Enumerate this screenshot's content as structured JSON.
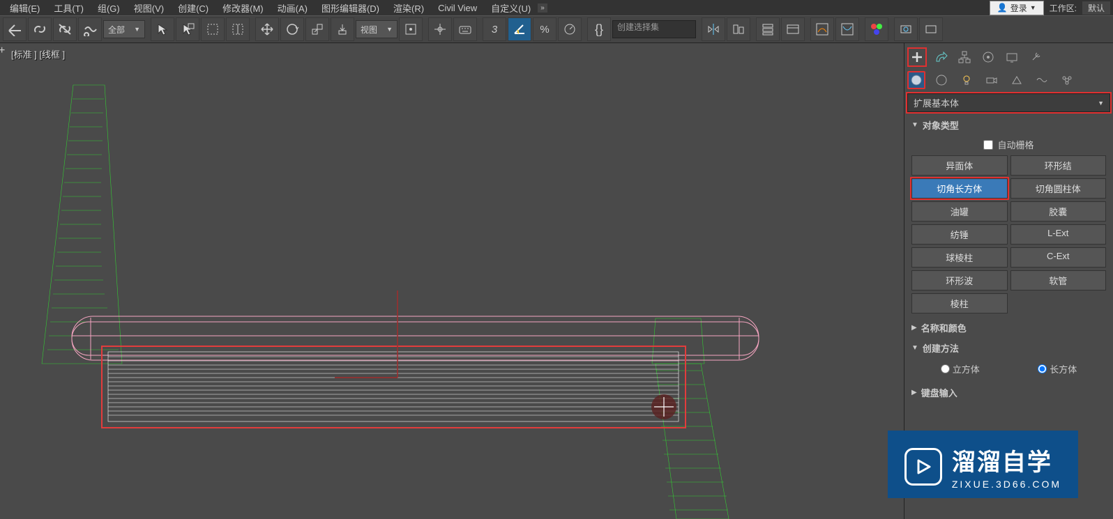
{
  "menu": {
    "items": [
      "编辑(E)",
      "工具(T)",
      "组(G)",
      "视图(V)",
      "创建(C)",
      "修改器(M)",
      "动画(A)",
      "图形编辑器(D)",
      "渲染(R)",
      "Civil View",
      "自定义(U)"
    ],
    "login_label": "登录",
    "workspace_label": "工作区:",
    "workspace_value": "默认"
  },
  "toolbar": {
    "filter_value": "全部",
    "coord_value": "视图",
    "selection_set_placeholder": "创建选择集"
  },
  "viewport": {
    "label": "[标准 ] [线框 ]"
  },
  "panel": {
    "category": "扩展基本体",
    "rollup_object_type": "对象类型",
    "autogrid_label": "自动栅格",
    "objects": [
      {
        "label": "异面体",
        "active": false
      },
      {
        "label": "环形结",
        "active": false
      },
      {
        "label": "切角长方体",
        "active": true,
        "highlight": true
      },
      {
        "label": "切角圆柱体",
        "active": false
      },
      {
        "label": "油罐",
        "active": false
      },
      {
        "label": "胶囊",
        "active": false
      },
      {
        "label": "纺锤",
        "active": false
      },
      {
        "label": "L-Ext",
        "active": false
      },
      {
        "label": "球棱柱",
        "active": false
      },
      {
        "label": "C-Ext",
        "active": false
      },
      {
        "label": "环形波",
        "active": false
      },
      {
        "label": "软管",
        "active": false
      },
      {
        "label": "棱柱",
        "active": false
      },
      {
        "label": "",
        "active": false,
        "empty": true
      }
    ],
    "rollup_name_color": "名称和颜色",
    "rollup_create_method": "创建方法",
    "create_method": {
      "opt1": "立方体",
      "opt2": "长方体"
    },
    "rollup_keyboard": "键盘输入"
  },
  "watermark": {
    "main": "溜溜自学",
    "sub": "ZIXUE.3D66.COM"
  }
}
